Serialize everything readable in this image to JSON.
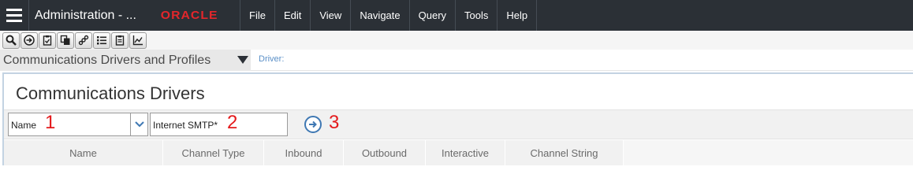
{
  "topbar": {
    "menu_icon": "hamburger-menu-icon",
    "app_title": "Administration - ...",
    "brand": "ORACLE",
    "menu": [
      "File",
      "Edit",
      "View",
      "Navigate",
      "Query",
      "Tools",
      "Help"
    ]
  },
  "toolbar": {
    "buttons": [
      "search-icon",
      "go-arrow-icon",
      "clipboard-check-icon",
      "copy-icon",
      "link-icon",
      "list-icon",
      "clipboard-icon",
      "chart-icon"
    ]
  },
  "screen": {
    "selector_label": "Communications Drivers and Profiles",
    "breadcrumb": "Driver:"
  },
  "applet": {
    "title": "Communications Drivers",
    "query": {
      "field_value": "Name",
      "search_value": "Internet SMTP*",
      "go_icon": "go-arrow-icon"
    },
    "annotations": [
      "1",
      "2",
      "3"
    ],
    "columns": [
      "Name",
      "Channel Type",
      "Inbound",
      "Outbound",
      "Interactive",
      "Channel String"
    ]
  },
  "colors": {
    "topbar_bg": "#2b3036",
    "brand_red": "#e3262b",
    "link_blue": "#3f78b3",
    "annotation_red": "#e41a1c"
  }
}
